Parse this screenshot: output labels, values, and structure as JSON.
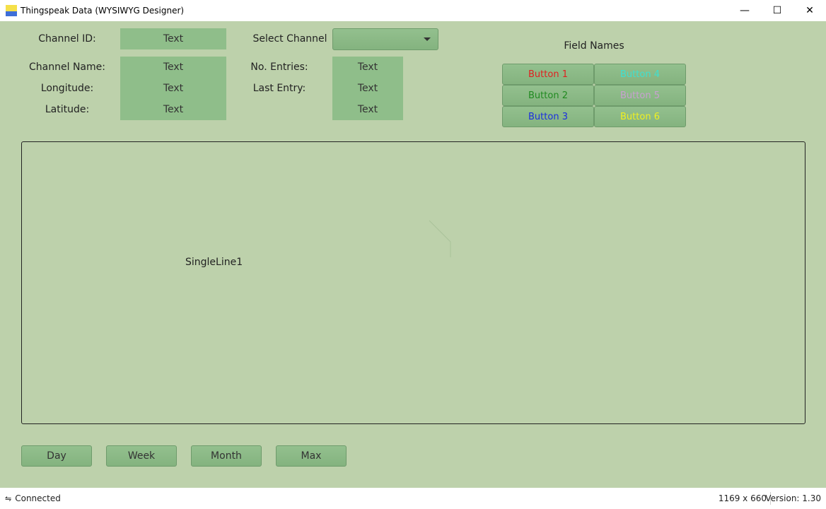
{
  "window": {
    "title": "Thingspeak Data (WYSIWYG Designer)",
    "minimize": "—",
    "maximize": "☐",
    "close": "✕"
  },
  "labels": {
    "channel_id": "Channel ID:",
    "select_channel": "Select Channel",
    "channel_name": "Channel Name:",
    "longitude": "Longitude:",
    "latitude": "Latitude:",
    "no_entries": "No. Entries:",
    "last_entry": "Last Entry:",
    "field_names": "Field Names"
  },
  "values": {
    "channel_id": "Text",
    "channel_name": "Text",
    "longitude": "Text",
    "latitude": "Text",
    "no_entries": "Text",
    "last_entry": "Text",
    "extra": "Text"
  },
  "select_channel": {
    "value": ""
  },
  "field_buttons": [
    {
      "label": "Button 1",
      "color": "#e02020"
    },
    {
      "label": "Button 2",
      "color": "#208a20"
    },
    {
      "label": "Button 3",
      "color": "#1a2ee0"
    },
    {
      "label": "Button 4",
      "color": "#3fe0d0"
    },
    {
      "label": "Button 5",
      "color": "#c8a0d0"
    },
    {
      "label": "Button 6",
      "color": "#f0f020"
    }
  ],
  "chart": {
    "series_label": "SingleLine1"
  },
  "range_buttons": [
    "Day",
    "Week",
    "Month",
    "Max"
  ],
  "status": {
    "connection": "Connected",
    "size": "1169 x 660",
    "version": "Version: 1.30"
  }
}
